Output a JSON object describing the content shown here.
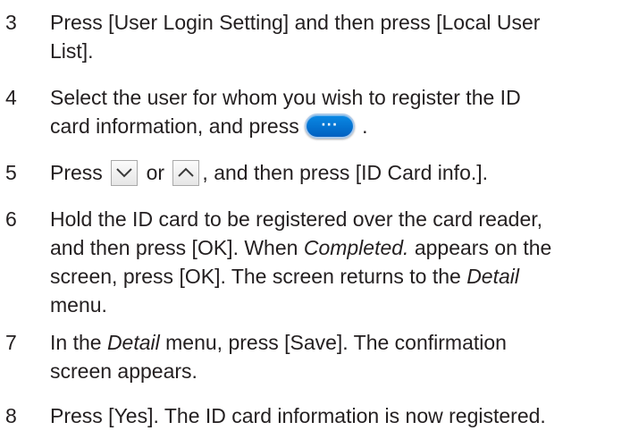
{
  "steps": [
    {
      "num": "3",
      "line1": "Press [User Login Setting] and then press [Local User",
      "line2": "List]."
    },
    {
      "num": "4",
      "line1": "Select the user for whom you wish to register the ID",
      "line2_before": "card information, and press",
      "line2_after": " .",
      "icon": "ellipsis-pill-button-icon"
    },
    {
      "num": "5",
      "part_a": "Press ",
      "part_b": " or ",
      "part_c": ", and then press [ID Card info.].",
      "icons": [
        "chevron-down-button-icon",
        "chevron-up-button-icon"
      ]
    },
    {
      "num": "6",
      "line1": "Hold the ID card to be registered over the card reader,",
      "line2_a": "and then press [OK]. When ",
      "line2_em": "Completed.",
      "line2_b": " appears on the",
      "line3_a": "screen, press [OK]. The screen returns to the ",
      "line3_em": "Detail",
      "line4": "menu."
    },
    {
      "num": "7",
      "line1_a": "In the ",
      "line1_em": "Detail",
      "line1_b": " menu, press [Save]. The confirmation",
      "line2": "screen appears."
    },
    {
      "num": "8",
      "line1": "Press [Yes]. The ID card information is now registered."
    }
  ]
}
